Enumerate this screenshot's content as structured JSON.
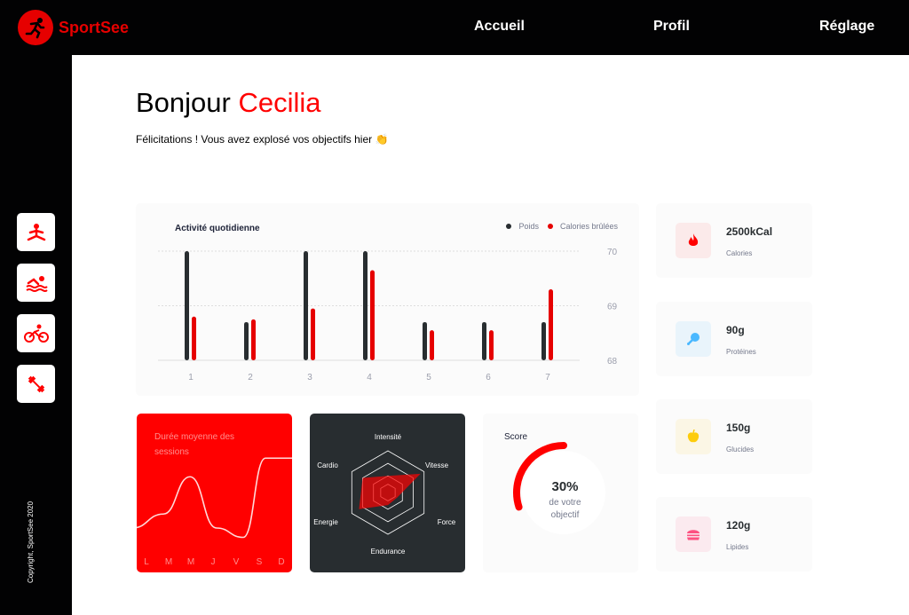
{
  "header": {
    "brand": "SportSee",
    "nav": [
      "Accueil",
      "Profil",
      "Réglage"
    ]
  },
  "sidebar": {
    "icons": [
      "yoga-icon",
      "swimming-icon",
      "cycling-icon",
      "dumbbell-icon"
    ],
    "copyright": "Copyright, SportSee 2020"
  },
  "greeting": {
    "hello": "Bonjour",
    "name": "Cecilia",
    "message": "Félicitations ! Vous avez explosé vos objectifs hier 👏"
  },
  "colors": {
    "accent": "#ff0101",
    "dark": "#282d30",
    "card": "#fbfbfb"
  },
  "chart_data": [
    {
      "type": "bar",
      "title": "Activité quotidienne",
      "categories": [
        "1",
        "2",
        "3",
        "4",
        "5",
        "6",
        "7"
      ],
      "series": [
        {
          "name": "Poids",
          "color": "#282d30",
          "values": [
            70,
            68.7,
            70,
            70,
            68.7,
            68.7,
            68.7
          ]
        },
        {
          "name": "Calories brûlées",
          "color": "#e60000",
          "values": [
            68.8,
            68.75,
            68.95,
            69.65,
            68.55,
            68.55,
            69.3
          ]
        }
      ],
      "yticks": [
        70,
        69,
        68
      ],
      "ylim": [
        68,
        70
      ],
      "grid": "dashed horizontal",
      "legend": "top-right"
    },
    {
      "type": "line",
      "title": "Durée moyenne des sessions",
      "categories": [
        "L",
        "M",
        "M",
        "J",
        "V",
        "S",
        "D"
      ],
      "values": [
        20,
        35,
        75,
        20,
        10,
        95,
        95
      ],
      "ylim": [
        0,
        100
      ]
    },
    {
      "type": "radar",
      "categories": [
        "Intensité",
        "Vitesse",
        "Force",
        "Endurance",
        "Energie",
        "Cardio"
      ],
      "values": [
        40,
        90,
        25,
        30,
        80,
        70
      ],
      "max": 100
    },
    {
      "type": "radial",
      "title": "Score",
      "value": 0.3,
      "label_value": "30%",
      "label_line1": "de votre",
      "label_line2": "objectif"
    }
  ],
  "key_data": [
    {
      "value": "2500kCal",
      "label": "Calories",
      "icon": "fire-icon",
      "bg": "#fbeaea",
      "color": "#ff0000"
    },
    {
      "value": "90g",
      "label": "Protéines",
      "icon": "chicken-icon",
      "bg": "#e9f4fb",
      "color": "#4ab8ff"
    },
    {
      "value": "150g",
      "label": "Glucides",
      "icon": "apple-icon",
      "bg": "#fbf6e5",
      "color": "#fdcc0c"
    },
    {
      "value": "120g",
      "label": "Lipides",
      "icon": "burger-icon",
      "bg": "#fbeaef",
      "color": "#fd5181"
    }
  ]
}
